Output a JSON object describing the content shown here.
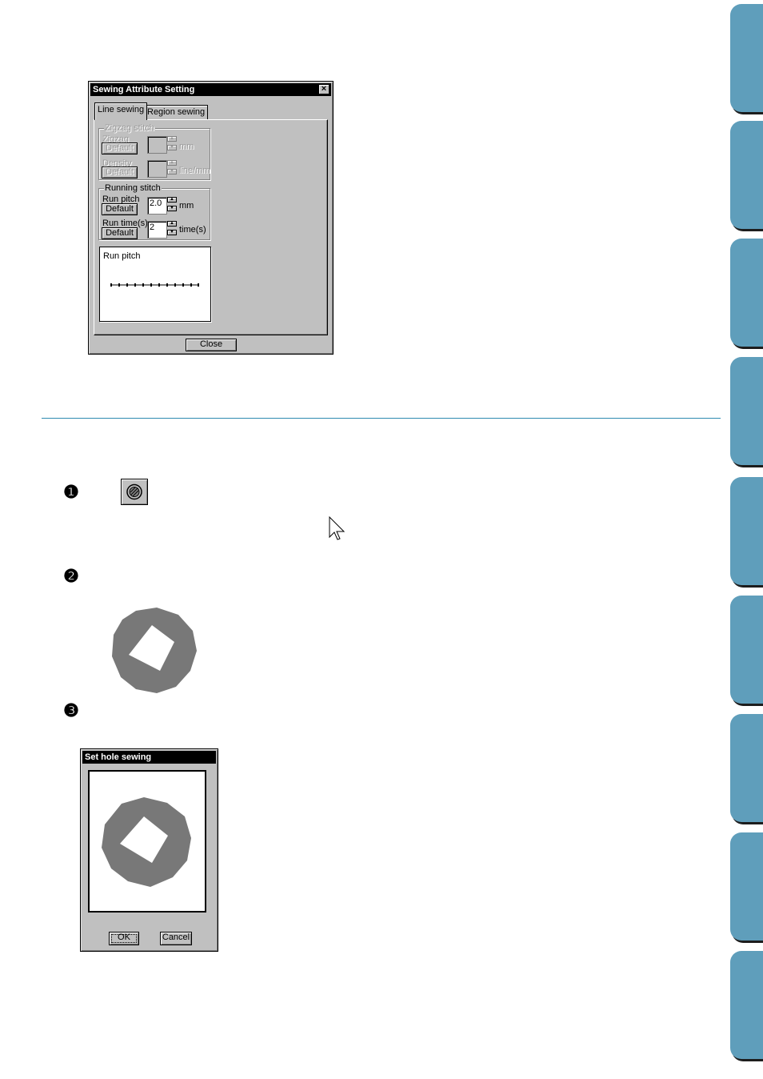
{
  "sewing_dialog": {
    "title": "Sewing Attribute Setting",
    "close_glyph": "×",
    "tabs": [
      {
        "label": "Line sewing",
        "selected": true
      },
      {
        "label": "Region sewing",
        "selected": false
      }
    ],
    "zigzag": {
      "group_title": "Zigzag stitch",
      "zigzag_label": "Zigzag",
      "zigzag_unit": "mm",
      "density_label": "Density",
      "density_unit": "line/mm",
      "default_label": "Default"
    },
    "running": {
      "group_title": "Running stitch",
      "pitch_label": "Run pitch",
      "pitch_value": "2.0",
      "pitch_unit": "mm",
      "times_label": "Run time(s)",
      "times_value": "2",
      "times_unit": "time(s)",
      "default_label": "Default"
    },
    "preview_label": "Run pitch",
    "close_button": "Close"
  },
  "steps": {
    "one": "❶",
    "two": "❷",
    "three": "❸"
  },
  "icons": {
    "hole_sewing_tool": "hole-sewing-icon",
    "cursor": "arrow-cursor-icon"
  },
  "hole_dialog": {
    "title": "Set hole sewing",
    "ok_button": "OK",
    "cancel_button": "Cancel"
  },
  "colors": {
    "side_tab": "#5f9ebb",
    "divider": "#2e8ab0",
    "shape": "#787878"
  }
}
